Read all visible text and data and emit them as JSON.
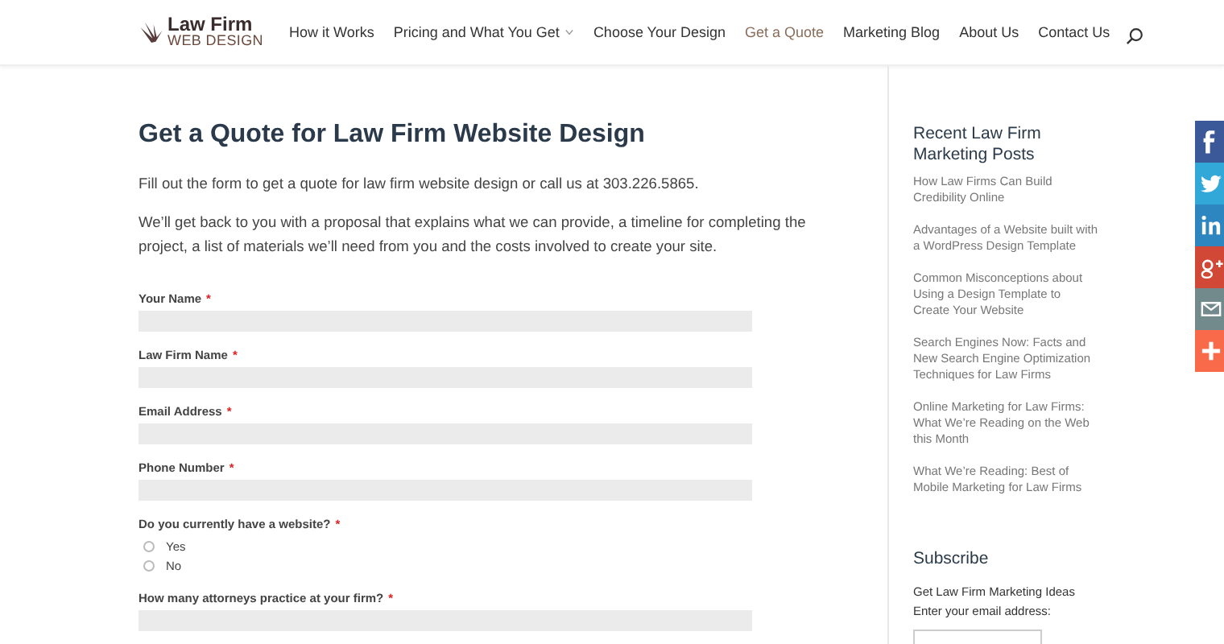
{
  "logo": {
    "line1": "Law Firm",
    "line2": "WEB DESIGN"
  },
  "nav": [
    {
      "label": "How it Works",
      "selected": false,
      "dropdown": false
    },
    {
      "label": "Pricing and What You Get",
      "selected": false,
      "dropdown": true
    },
    {
      "label": "Choose Your Design",
      "selected": false,
      "dropdown": false
    },
    {
      "label": "Get a Quote",
      "selected": true,
      "dropdown": false
    },
    {
      "label": "Marketing Blog",
      "selected": false,
      "dropdown": false
    },
    {
      "label": "About Us",
      "selected": false,
      "dropdown": false
    },
    {
      "label": "Contact Us",
      "selected": false,
      "dropdown": false
    }
  ],
  "main": {
    "title": "Get a Quote for Law Firm Website Design",
    "paragraphs": [
      "Fill out the form to get a quote for law firm website design or call us at 303.226.5865.",
      "We’ll get back to you with a proposal that explains what we can provide, a timeline for completing the project, a list of materials we’ll need from you and the costs involved to create your site."
    ],
    "fields": [
      {
        "kind": "text",
        "label": "Your Name",
        "mark": "*"
      },
      {
        "kind": "text",
        "label": "Law Firm Name",
        "mark": "*"
      },
      {
        "kind": "text",
        "label": "Email Address",
        "mark": "*"
      },
      {
        "kind": "text",
        "label": "Phone Number",
        "mark": "*"
      },
      {
        "kind": "radio",
        "label": "Do you currently have a website?",
        "mark": "*",
        "options": [
          {
            "label": "Yes",
            "selected": false
          },
          {
            "label": "No",
            "selected": false
          }
        ]
      },
      {
        "kind": "text",
        "label": "How many attorneys practice at your firm?",
        "mark": "*"
      }
    ]
  },
  "sidebar": {
    "title": "Recent Law Firm Marketing Posts",
    "posts": [
      "How Law Firms Can Build Credibility Online",
      "Advantages of a Website built with a WordPress Design Template",
      "Common Misconceptions about Using a Design Template to Create Your Website",
      "Search Engines Now: Facts and New Search Engine Optimization Techniques for Law Firms",
      "Online Marketing for Law Firms: What We’re Reading on the Web this Month",
      "What We’re Reading: Best of Mobile Marketing for Law Firms"
    ],
    "subscribe_title": "Subscribe",
    "subscribe_lines": [
      "Get Law Firm Marketing Ideas",
      "Enter your email address:"
    ]
  },
  "share": [
    {
      "kind": "facebook",
      "color": "#3b5998"
    },
    {
      "kind": "twitter",
      "color": "#32a8d8"
    },
    {
      "kind": "linkedin",
      "color": "#2e86c1"
    },
    {
      "kind": "google",
      "color": "#d14836"
    },
    {
      "kind": "email",
      "color": "#738a8d"
    },
    {
      "kind": "more",
      "color": "#f96a4b"
    }
  ]
}
